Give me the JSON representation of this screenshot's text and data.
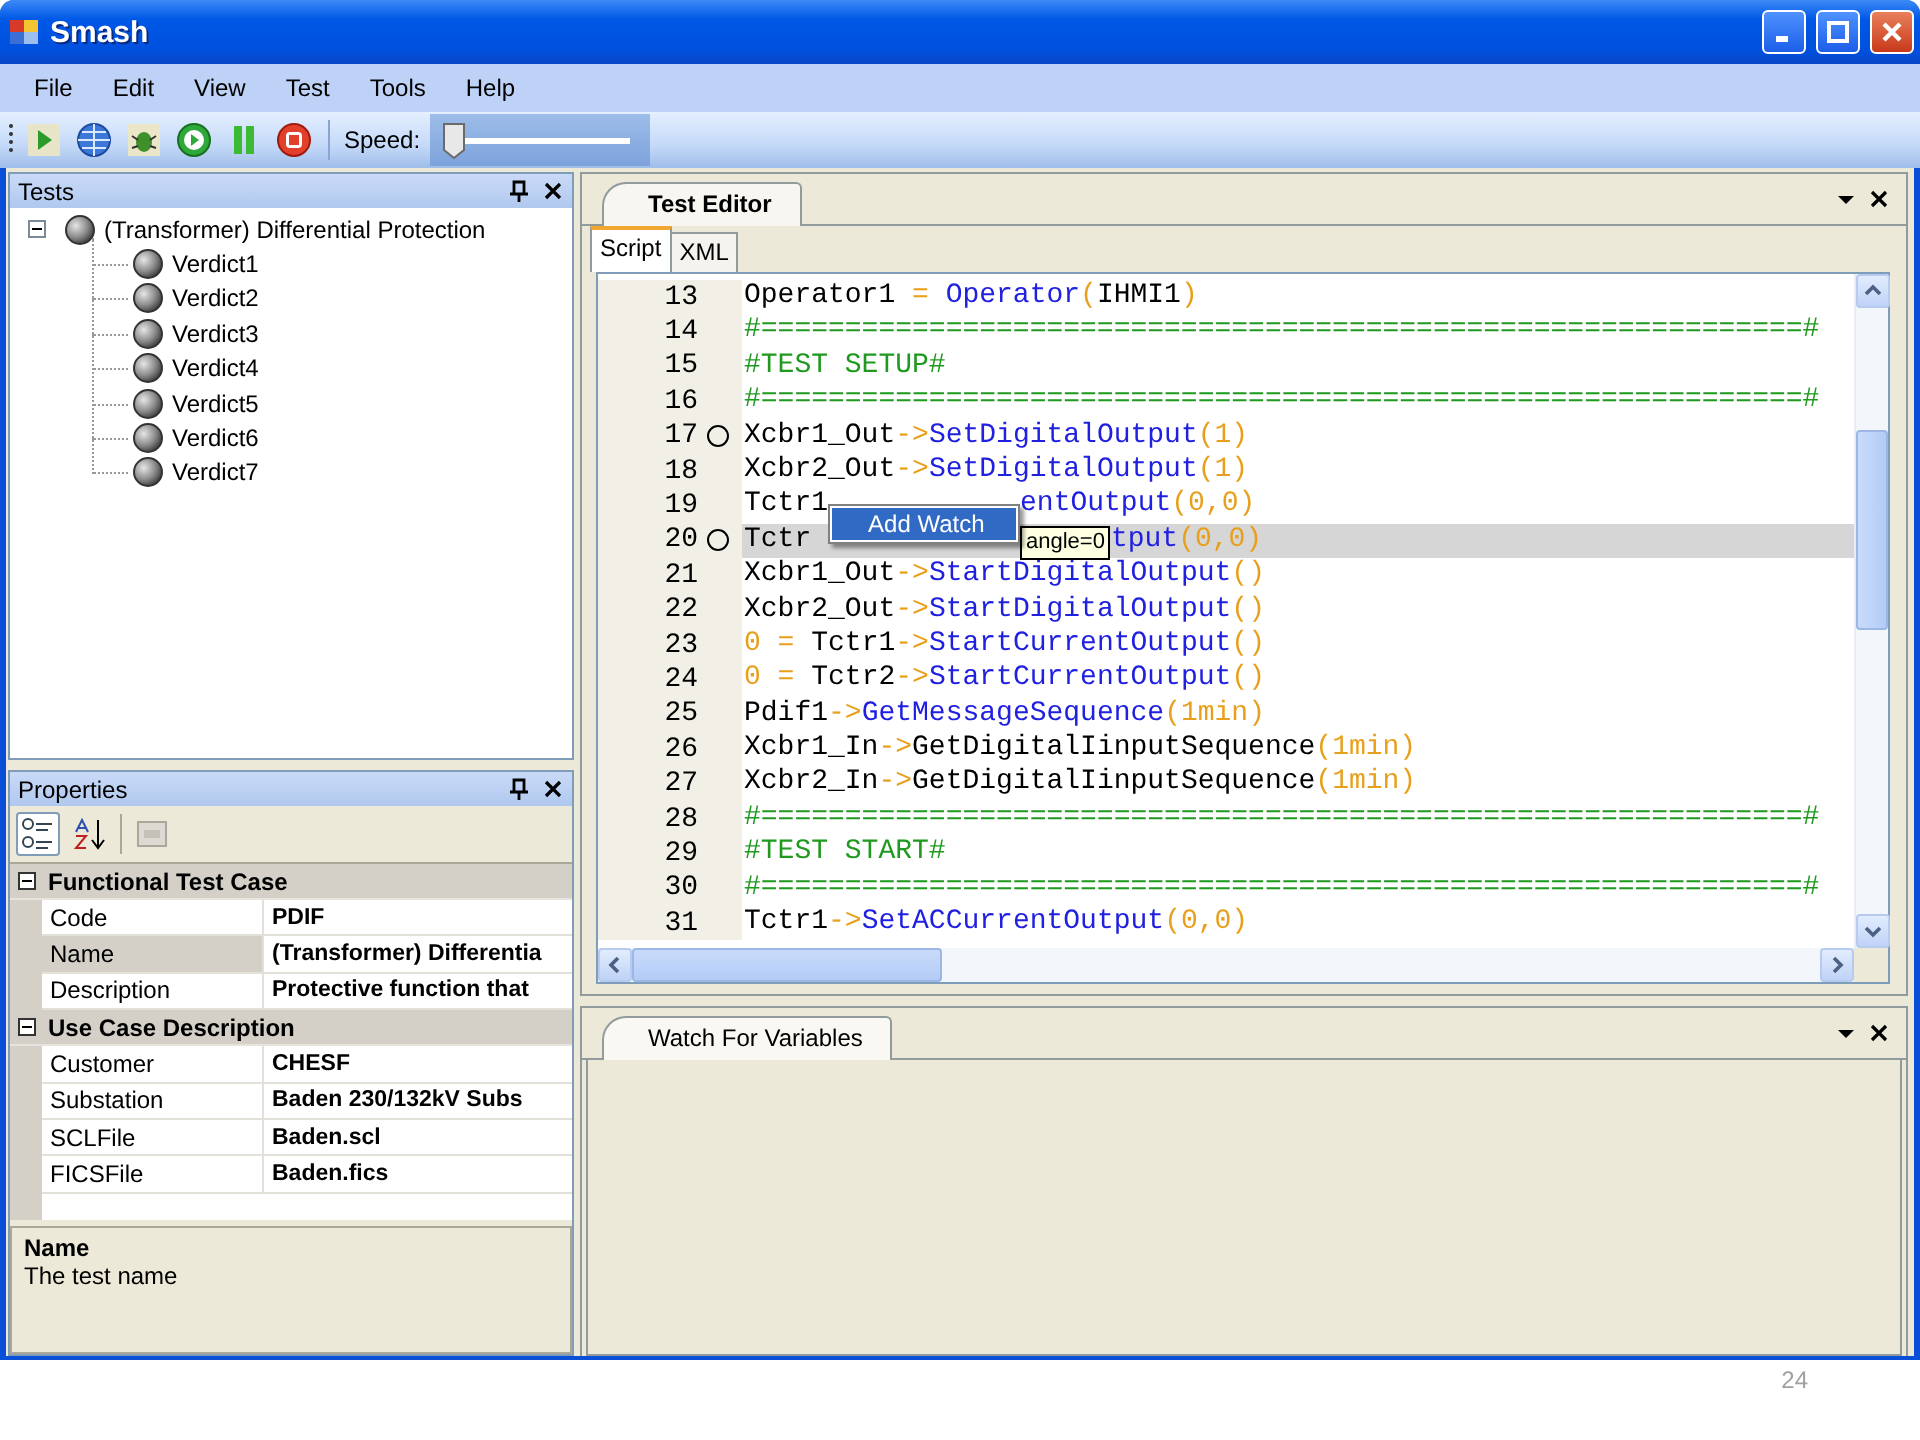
{
  "window": {
    "title": "Smash"
  },
  "menu": [
    "File",
    "Edit",
    "View",
    "Test",
    "Tools",
    "Help"
  ],
  "toolbar": {
    "speed_label": "Speed:",
    "speed": {
      "level": 0
    }
  },
  "tests_panel": {
    "title": "Tests",
    "tree": [
      {
        "label": "(Transformer) Differential Protection",
        "expanded": true,
        "children": [
          {
            "label": "Verdict1"
          },
          {
            "label": "Verdict2"
          },
          {
            "label": "Verdict3"
          },
          {
            "label": "Verdict4"
          },
          {
            "label": "Verdict5"
          },
          {
            "label": "Verdict6"
          },
          {
            "label": "Verdict7"
          }
        ]
      }
    ]
  },
  "properties_panel": {
    "title": "Properties",
    "categories": [
      {
        "name": "Functional Test Case",
        "expanded": true,
        "rows": [
          {
            "name": "Code",
            "value": "PDIF",
            "selected": false
          },
          {
            "name": "Name",
            "value": "(Transformer) Differentia",
            "selected": true
          },
          {
            "name": "Description",
            "value": "Protective function that",
            "selected": false
          }
        ]
      },
      {
        "name": "Use Case Description",
        "expanded": true,
        "rows": [
          {
            "name": "Customer",
            "value": "CHESF",
            "selected": false
          },
          {
            "name": "Substation",
            "value": "Baden 230/132kV Subs",
            "selected": false
          },
          {
            "name": "SCLFile",
            "value": "Baden.scl",
            "selected": false
          },
          {
            "name": "FICSFile",
            "value": "Baden.fics",
            "selected": false
          }
        ]
      }
    ],
    "description": {
      "title": "Name",
      "text": "The test name"
    }
  },
  "editor": {
    "tabs": [
      {
        "label": "Test Editor",
        "selected": true
      }
    ],
    "subtabs": [
      {
        "label": "Script",
        "selected": true
      },
      {
        "label": "XML",
        "selected": false
      }
    ],
    "lines": [
      {
        "number": "13",
        "marker": false,
        "highlighted": false,
        "tokens": [
          {
            "kind": "plain",
            "text": "Operator1 "
          },
          {
            "kind": "op",
            "text": "= "
          },
          {
            "kind": "fn",
            "text": "Operator"
          },
          {
            "kind": "op",
            "text": "("
          },
          {
            "kind": "plain",
            "text": "IHMI1"
          },
          {
            "kind": "op",
            "text": ")"
          }
        ]
      },
      {
        "number": "14",
        "marker": false,
        "highlighted": false,
        "tokens": [
          {
            "kind": "comment",
            "text": "#==============================================================#"
          }
        ]
      },
      {
        "number": "15",
        "marker": false,
        "highlighted": false,
        "tokens": [
          {
            "kind": "comment",
            "text": "#TEST SETUP#"
          }
        ]
      },
      {
        "number": "16",
        "marker": false,
        "highlighted": false,
        "tokens": [
          {
            "kind": "comment",
            "text": "#==============================================================#"
          }
        ]
      },
      {
        "number": "17",
        "marker": true,
        "highlighted": false,
        "tokens": [
          {
            "kind": "plain",
            "text": "Xcbr1_Out"
          },
          {
            "kind": "op",
            "text": "->"
          },
          {
            "kind": "fn",
            "text": "SetDigitalOutput"
          },
          {
            "kind": "op",
            "text": "(1)"
          }
        ]
      },
      {
        "number": "18",
        "marker": false,
        "highlighted": false,
        "tokens": [
          {
            "kind": "plain",
            "text": "Xcbr2_Out"
          },
          {
            "kind": "op",
            "text": "->"
          },
          {
            "kind": "fn",
            "text": "SetDigitalOutput"
          },
          {
            "kind": "op",
            "text": "(1)"
          }
        ]
      },
      {
        "number": "19",
        "marker": false,
        "highlighted": false,
        "tokens": [
          {
            "kind": "plain",
            "text": "Tctr1"
          },
          {
            "kind": "menu",
            "items": [
              {
                "label": "Add Watch",
                "selected": true
              }
            ]
          },
          {
            "kind": "fn",
            "text": "entOutput"
          },
          {
            "kind": "op",
            "text": "(0,0)"
          }
        ]
      },
      {
        "number": "20",
        "marker": true,
        "highlighted": true,
        "tokens": [
          {
            "kind": "plain",
            "text": "Tctr"
          },
          {
            "kind": "covered"
          },
          {
            "kind": "tooltip",
            "text": "angle=0"
          },
          {
            "kind": "fn",
            "text": "tput"
          },
          {
            "kind": "op",
            "text": "(0,0)"
          }
        ]
      },
      {
        "number": "21",
        "marker": false,
        "highlighted": false,
        "tokens": [
          {
            "kind": "plain",
            "text": "Xcbr1_Out"
          },
          {
            "kind": "op",
            "text": "->"
          },
          {
            "kind": "fn",
            "text": "StartDigitalOutput"
          },
          {
            "kind": "op",
            "text": "()"
          }
        ]
      },
      {
        "number": "22",
        "marker": false,
        "highlighted": false,
        "tokens": [
          {
            "kind": "plain",
            "text": "Xcbr2_Out"
          },
          {
            "kind": "op",
            "text": "->"
          },
          {
            "kind": "fn",
            "text": "StartDigitalOutput"
          },
          {
            "kind": "op",
            "text": "()"
          }
        ]
      },
      {
        "number": "23",
        "marker": false,
        "highlighted": false,
        "tokens": [
          {
            "kind": "op",
            "text": "0 = "
          },
          {
            "kind": "plain",
            "text": "Tctr1"
          },
          {
            "kind": "op",
            "text": "->"
          },
          {
            "kind": "fn",
            "text": "StartCurrentOutput"
          },
          {
            "kind": "op",
            "text": "()"
          }
        ]
      },
      {
        "number": "24",
        "marker": false,
        "highlighted": false,
        "tokens": [
          {
            "kind": "op",
            "text": "0 = "
          },
          {
            "kind": "plain",
            "text": "Tctr2"
          },
          {
            "kind": "op",
            "text": "->"
          },
          {
            "kind": "fn",
            "text": "StartCurrentOutput"
          },
          {
            "kind": "op",
            "text": "()"
          }
        ]
      },
      {
        "number": "25",
        "marker": false,
        "highlighted": false,
        "tokens": [
          {
            "kind": "plain",
            "text": "Pdif1"
          },
          {
            "kind": "op",
            "text": "->"
          },
          {
            "kind": "fn",
            "text": "GetMessageSequence"
          },
          {
            "kind": "op",
            "text": "(1min)"
          }
        ]
      },
      {
        "number": "26",
        "marker": false,
        "highlighted": false,
        "tokens": [
          {
            "kind": "plain",
            "text": "Xcbr1_In"
          },
          {
            "kind": "op",
            "text": "->"
          },
          {
            "kind": "plain",
            "text": "GetDigitalIinputSequence"
          },
          {
            "kind": "op",
            "text": "(1min)"
          }
        ]
      },
      {
        "number": "27",
        "marker": false,
        "highlighted": false,
        "tokens": [
          {
            "kind": "plain",
            "text": "Xcbr2_In"
          },
          {
            "kind": "op",
            "text": "->"
          },
          {
            "kind": "plain",
            "text": "GetDigitalIinputSequence"
          },
          {
            "kind": "op",
            "text": "(1min)"
          }
        ]
      },
      {
        "number": "28",
        "marker": false,
        "highlighted": false,
        "tokens": [
          {
            "kind": "comment",
            "text": "#==============================================================#"
          }
        ]
      },
      {
        "number": "29",
        "marker": false,
        "highlighted": false,
        "tokens": [
          {
            "kind": "comment",
            "text": "#TEST START#"
          }
        ]
      },
      {
        "number": "30",
        "marker": false,
        "highlighted": false,
        "tokens": [
          {
            "kind": "comment",
            "text": "#==============================================================#"
          }
        ]
      },
      {
        "number": "31",
        "marker": false,
        "highlighted": false,
        "tokens": [
          {
            "kind": "plain",
            "text": "Tctr1"
          },
          {
            "kind": "op",
            "text": "->"
          },
          {
            "kind": "fn",
            "text": "SetACCurrentOutput"
          },
          {
            "kind": "op",
            "text": "(0,0)"
          }
        ]
      }
    ]
  },
  "watch": {
    "tabs": [
      {
        "label": "Watch For Variables",
        "selected": true
      }
    ]
  },
  "slide_number": "24"
}
